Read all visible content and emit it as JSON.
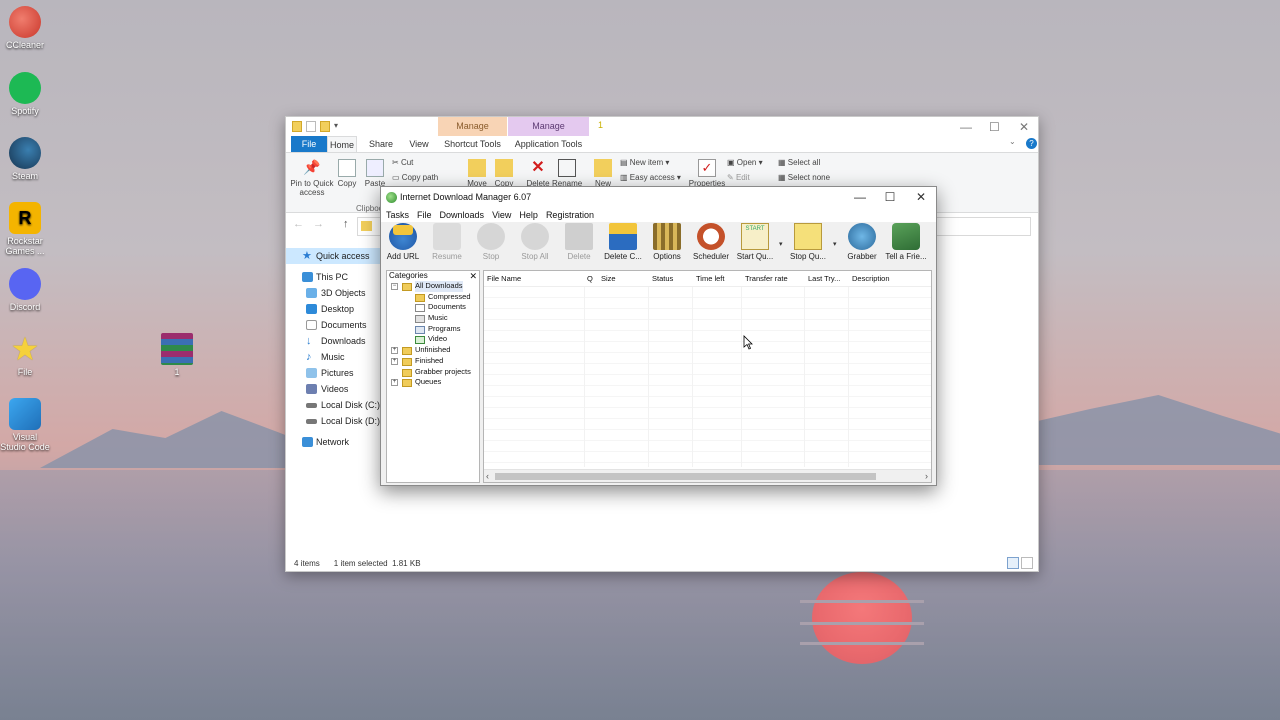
{
  "desktop": {
    "icons": [
      {
        "label": "CCleaner",
        "icon": "ccleaner-icon",
        "color": "#d84b3c"
      },
      {
        "label": "Spotify",
        "icon": "spotify-icon",
        "color": "#1db954"
      },
      {
        "label": "Steam",
        "icon": "steam-icon",
        "color": "#1b2838"
      },
      {
        "label": "Rockstar Games ...",
        "icon": "rockstar-icon",
        "color": "#f4b400"
      },
      {
        "label": "Discord",
        "icon": "discord-icon",
        "color": "#5865f2"
      },
      {
        "label": "File",
        "icon": "star-icon",
        "color": "#f5d13b"
      },
      {
        "label": "Visual Studio Code",
        "icon": "vscode-icon",
        "color": "#2b8ad8"
      },
      {
        "label": "1",
        "icon": "winrar-archive-icon",
        "color": "#9b2d6d"
      }
    ]
  },
  "explorer": {
    "context_tabs": [
      "Manage",
      "Manage"
    ],
    "title_number": "1",
    "tabs": [
      "File",
      "Home",
      "Share",
      "View",
      "Shortcut Tools",
      "Application Tools"
    ],
    "ribbon": {
      "pin": "Pin to Quick access",
      "copy": "Copy",
      "paste": "Paste",
      "cut": "Cut",
      "copy_path": "Copy path",
      "clipboard_group": "Clipboo",
      "move": "Move",
      "copy_to": "Copy",
      "delete": "Delete",
      "rename": "Rename",
      "new": "New",
      "new_item": "New item",
      "easy_access": "Easy access",
      "properties": "Properties",
      "open": "Open",
      "edit": "Edit",
      "select_all": "Select all",
      "select_none": "Select none"
    },
    "nav": {
      "quick_access": "Quick access",
      "this_pc": "This PC",
      "items": [
        "3D Objects",
        "Desktop",
        "Documents",
        "Downloads",
        "Music",
        "Pictures",
        "Videos",
        "Local Disk (C:)",
        "Local Disk (D:)"
      ],
      "network": "Network"
    },
    "status": {
      "items": "4 items",
      "selected": "1 item selected",
      "size": "1.81 KB"
    }
  },
  "idm": {
    "title": "Internet Download Manager 6.07",
    "menu": [
      "Tasks",
      "File",
      "Downloads",
      "View",
      "Help",
      "Registration"
    ],
    "toolbar": [
      {
        "label": "Add URL",
        "enabled": true
      },
      {
        "label": "Resume",
        "enabled": false
      },
      {
        "label": "Stop",
        "enabled": false
      },
      {
        "label": "Stop All",
        "enabled": false
      },
      {
        "label": "Delete",
        "enabled": false
      },
      {
        "label": "Delete C...",
        "enabled": true
      },
      {
        "label": "Options",
        "enabled": true
      },
      {
        "label": "Scheduler",
        "enabled": true
      },
      {
        "label": "Start Qu...",
        "enabled": true
      },
      {
        "label": "Stop Qu...",
        "enabled": true
      },
      {
        "label": "Grabber",
        "enabled": true
      },
      {
        "label": "Tell a Frie...",
        "enabled": true
      }
    ],
    "categories": {
      "header": "Categories",
      "all_downloads": "All Downloads",
      "sub": [
        "Compressed",
        "Documents",
        "Music",
        "Programs",
        "Video"
      ],
      "other": [
        "Unfinished",
        "Finished",
        "Grabber projects",
        "Queues"
      ]
    },
    "columns": [
      "File Name",
      "Q",
      "Size",
      "Status",
      "Time left",
      "Transfer rate",
      "Last Try...",
      "Description"
    ]
  }
}
